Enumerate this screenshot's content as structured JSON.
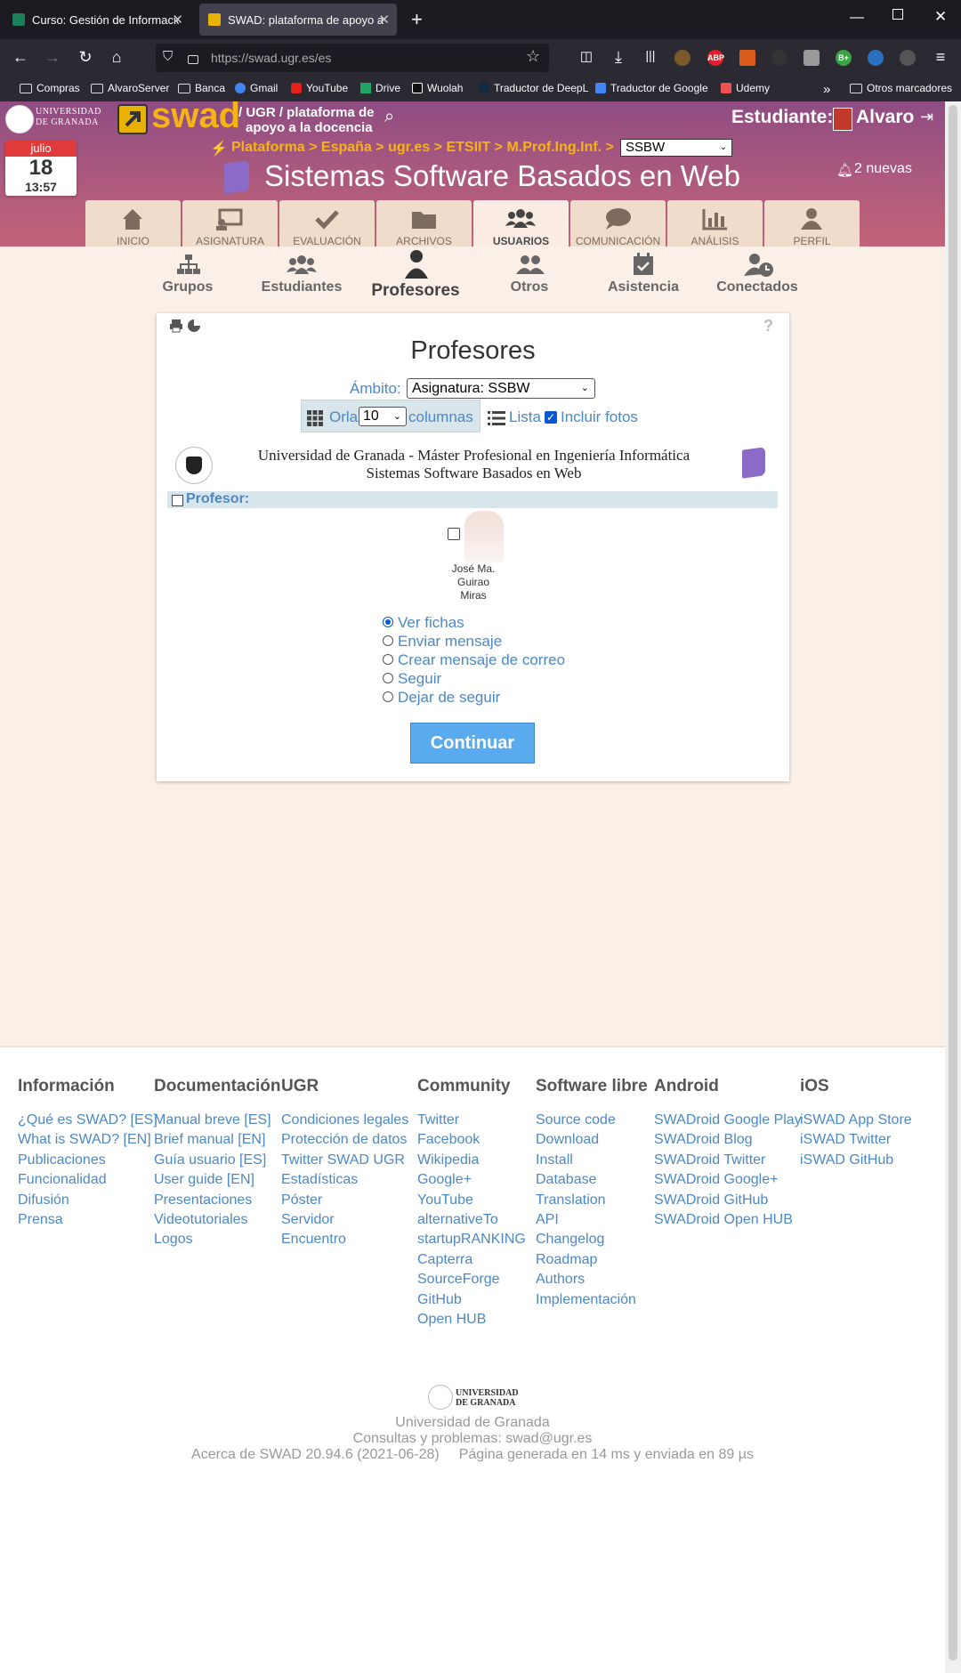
{
  "browser": {
    "tabs": [
      {
        "title": "Curso: Gestión de Información"
      },
      {
        "title": "SWAD: plataforma de apoyo a l"
      }
    ],
    "new_tab": "+",
    "url": "https://swad.ugr.es/es",
    "bookmarks": [
      "Compras",
      "AlvaroServer",
      "Banca",
      "Gmail",
      "YouTube",
      "Drive",
      "Wuolah",
      "Traductor de DeepL",
      "Traductor de Google",
      "Udemy"
    ],
    "other_bookmarks": "Otros marcadores"
  },
  "header": {
    "ugr_line1": "UNIVERSIDAD",
    "ugr_line2": "DE GRANADA",
    "swad_logo": "swad",
    "tagline_1": "/ UGR / plataforma de",
    "tagline_2": "apoyo a la docencia",
    "user_role": "Estudiante:",
    "user_name": "Alvaro",
    "breadcrumb": "Plataforma > España > ugr.es > ETSIIT > M.Prof.Ing.Inf. >",
    "course_select": "SSBW",
    "course_title": "Sistemas Software Basados en Web",
    "notifications": "2 nuevas",
    "calendar": {
      "month": "julio",
      "day": "18",
      "time": "13:57"
    }
  },
  "main_tabs": [
    {
      "label": "INICIO",
      "icon": "home-icon"
    },
    {
      "label": "ASIGNATURA",
      "icon": "chalkboard-icon"
    },
    {
      "label": "EVALUACIÓN",
      "icon": "check-icon"
    },
    {
      "label": "ARCHIVOS",
      "icon": "folder-icon"
    },
    {
      "label": "USUARIOS",
      "icon": "users-icon"
    },
    {
      "label": "COMUNICACIÓN",
      "icon": "comment-icon"
    },
    {
      "label": "ANÁLISIS",
      "icon": "chart-icon"
    },
    {
      "label": "PERFIL",
      "icon": "user-icon"
    }
  ],
  "sub_tabs": [
    {
      "label": "Grupos"
    },
    {
      "label": "Estudiantes"
    },
    {
      "label": "Profesores"
    },
    {
      "label": "Otros"
    },
    {
      "label": "Asistencia"
    },
    {
      "label": "Conectados"
    }
  ],
  "card": {
    "help": "?",
    "title": "Profesores",
    "scope_label": "Ámbito:",
    "scope_value": "Asignatura: SSBW",
    "orla_label": "Orla",
    "columns_value": "10",
    "columns_label": "columnas",
    "list_label": "Lista",
    "photos_label": "Incluir fotos",
    "institution_line1": "Universidad de Granada - Máster Profesional en Ingeniería Informática",
    "institution_line2": "Sistemas Software Basados en Web",
    "section_label": "Profesor:",
    "teacher_name": [
      "José Ma.",
      "Guirao",
      "Miras"
    ],
    "actions": [
      "Ver fichas",
      "Enviar mensaje",
      "Crear mensaje de correo",
      "Seguir",
      "Dejar de seguir"
    ],
    "continue_label": "Continuar"
  },
  "footer": {
    "columns": [
      {
        "title": "Información",
        "links": [
          "¿Qué es SWAD? [ES]",
          "What is SWAD? [EN]",
          "Publicaciones",
          "Funcionalidad",
          "Difusión",
          "Prensa"
        ]
      },
      {
        "title": "Documentación",
        "links": [
          "Manual breve [ES]",
          "Brief manual [EN]",
          "Guía usuario [ES]",
          "User guide [EN]",
          "Presentaciones",
          "Videotutoriales",
          "Logos"
        ]
      },
      {
        "title": "UGR",
        "links": [
          "Condiciones legales",
          "Protección de datos",
          "Twitter SWAD UGR",
          "Estadísticas",
          "Póster",
          "Servidor",
          "Encuentro"
        ]
      },
      {
        "title": "Community",
        "links": [
          "Twitter",
          "Facebook",
          "Wikipedia",
          "Google+",
          "YouTube",
          "alternativeTo",
          "startupRANKING",
          "Capterra",
          "SourceForge",
          "GitHub",
          "Open HUB"
        ]
      },
      {
        "title": "Software libre",
        "links": [
          "Source code",
          "Download",
          "Install",
          "Database",
          "Translation",
          "API",
          "Changelog",
          "Roadmap",
          "Authors",
          "Implementación"
        ]
      },
      {
        "title": "Android",
        "links": [
          "SWADroid Google Play",
          "SWADroid Blog",
          "SWADroid Twitter",
          "SWADroid Google+",
          "SWADroid GitHub",
          "SWADroid Open HUB"
        ]
      },
      {
        "title": "iOS",
        "links": [
          "iSWAD App Store",
          "iSWAD Twitter",
          "iSWAD GitHub"
        ]
      }
    ],
    "ugr_logo_1": "UNIVERSIDAD",
    "ugr_logo_2": "DE GRANADA",
    "university": "Universidad de Granada",
    "contact": "Consultas y problemas: swad@ugr.es",
    "version": "Acerca de SWAD 20.94.6 (2021-06-28)",
    "timing": "Página generada en 14 ms y enviada en 89 µs"
  }
}
